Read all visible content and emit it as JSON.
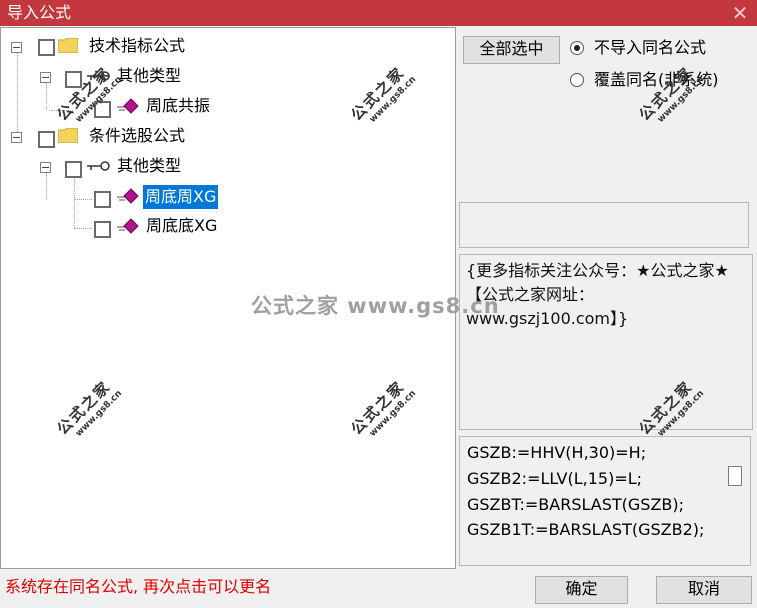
{
  "window": {
    "title": "导入公式",
    "close_glyph": "✕"
  },
  "tree": {
    "nodes": [
      {
        "label": "技术指标公式",
        "expander": "−"
      },
      {
        "label": "其他类型",
        "expander": "−"
      },
      {
        "label": "周底共振"
      },
      {
        "label": "条件选股公式",
        "expander": "−"
      },
      {
        "label": "其他类型",
        "expander": "−"
      },
      {
        "label": "周底周XG",
        "selected": true
      },
      {
        "label": "周底底XG"
      }
    ]
  },
  "actions": {
    "select_all": "全部选中",
    "radio_no_import": "不导入同名公式",
    "radio_overwrite": "覆盖同名(非系统)"
  },
  "description": "{更多指标关注公众号：★公式之家★ 【公式之家网址：www.gszj100.com】}",
  "code": [
    "GSZB:=HHV(H,30)=H;",
    "GSZB2:=LLV(L,15)=L;",
    "GSZBT:=BARSLAST(GSZB);",
    "GSZB1T:=BARSLAST(GSZB2);"
  ],
  "status": "系统存在同名公式, 再次点击可以更名",
  "buttons": {
    "ok": "确定",
    "cancel": "取消"
  },
  "watermark": {
    "center": "公式之家 www.gs8.cn",
    "tile_cn": "公式之家",
    "tile_url": "www.gs8.cn"
  },
  "colors": {
    "titlebar": "#c2383e",
    "selection": "#0078d7",
    "status_text": "#e00000",
    "indicator_icon": "#b0148c"
  }
}
